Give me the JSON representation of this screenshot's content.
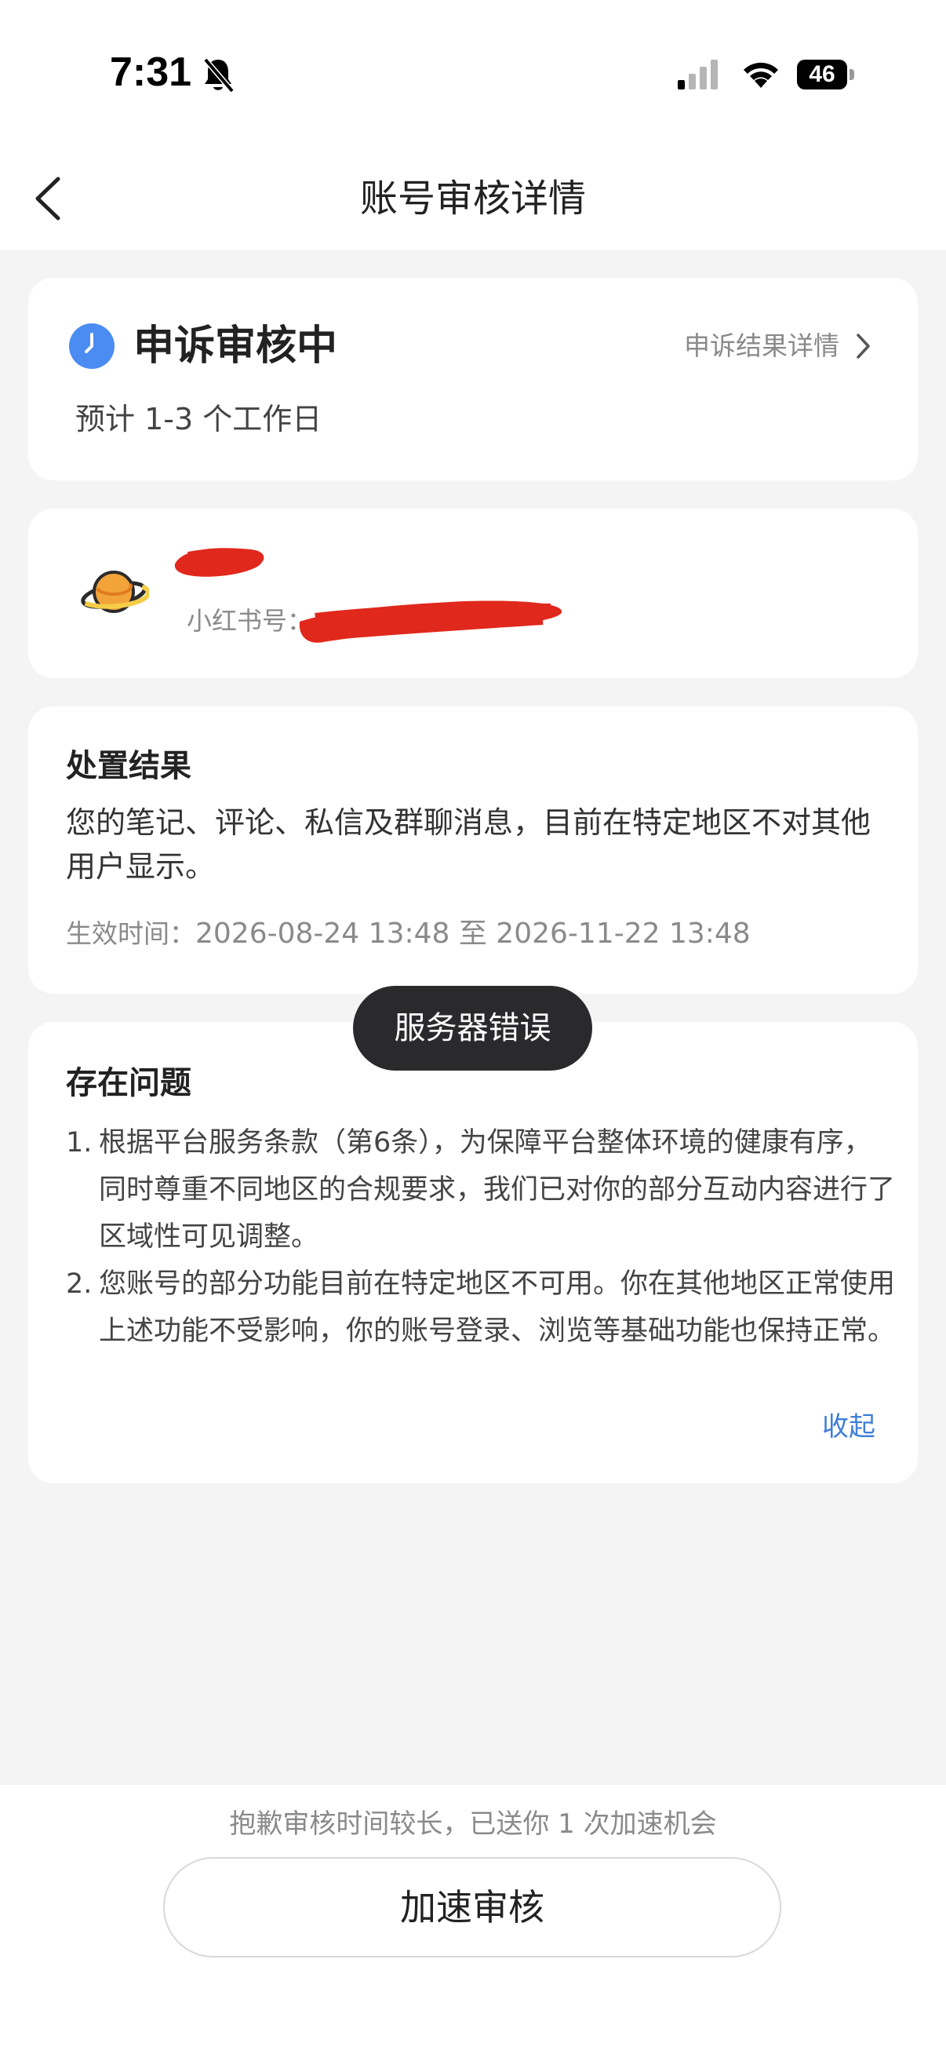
{
  "status_bar": {
    "time": "7:31",
    "battery": "46"
  },
  "header": {
    "title": "账号审核详情"
  },
  "review_status": {
    "label": "申诉审核中",
    "detail_link": "申诉结果详情",
    "eta": "预计 1-3 个工作日"
  },
  "account": {
    "id_label": "小红书号："
  },
  "result": {
    "title": "处置结果",
    "text": "您的笔记、评论、私信及群聊消息，目前在特定地区不对其他用户显示。",
    "effective_label": "生效时间：",
    "effective_range": "2026-08-24 13:48 至 2026-11-22 13:48"
  },
  "issues": {
    "title": "存在问题",
    "items": [
      {
        "num": "1.",
        "text": "根据平台服务条款（第6条），为保障平台整体环境的健康有序，同时尊重不同地区的合规要求，我们已对你的部分互动内容进行了区域性可见调整。"
      },
      {
        "num": "2.",
        "text": "您账号的部分功能目前在特定地区不可用。你在其他地区正常使用上述功能不受影响，你的账号登录、浏览等基础功能也保持正常。"
      }
    ],
    "collapse_label": "收起"
  },
  "toast": {
    "text": "服务器错误"
  },
  "bottom": {
    "note": "抱歉审核时间较长，已送你 1 次加速机会",
    "button_label": "加速审核"
  },
  "colors": {
    "accent_blue": "#4a8cf2",
    "link_blue": "#3f7fd8",
    "redaction_red": "#e0281c",
    "toast_bg": "#2a2a2c"
  }
}
